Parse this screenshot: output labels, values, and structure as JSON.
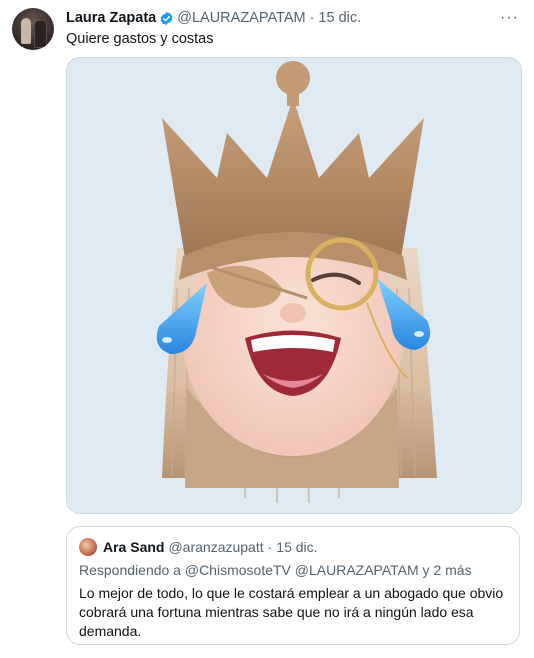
{
  "tweet": {
    "author_name": "Laura Zapata",
    "handle": "@LAURAZAPATAM",
    "separator": "·",
    "date": "15 dic.",
    "text": "Quiere gastos y costas",
    "more_label": "···",
    "media_description_icon": "memoji-crown-laughing-tears"
  },
  "quote": {
    "author_name": "Ara Sand",
    "handle": "@aranzazupatt",
    "separator": "·",
    "date": "15 dic.",
    "replying_to": "Respondiendo a @ChismosoteTV @LAURAZAPATAM y 2 más",
    "text": "Lo mejor de todo, lo que le costará emplear a un abogado que obvio cobrará una fortuna mientras sabe que no irá a ningún lado esa demanda."
  },
  "colors": {
    "verified": "#1d9bf0",
    "secondary_text": "#536471",
    "border": "#cfd9de",
    "media_background": "#dfeaf3"
  }
}
